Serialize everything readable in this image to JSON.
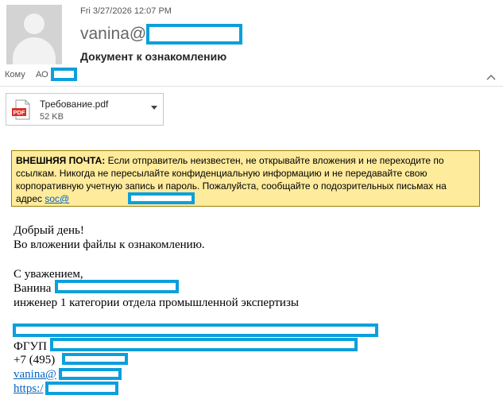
{
  "header": {
    "date": "Fri 3/27/2026 12:07 PM",
    "sender": "vanina@",
    "subject": "Документ к ознакомлению",
    "to_label": "Кому",
    "to_value": "АО"
  },
  "attachment": {
    "name": "Требование.pdf",
    "size": "52 KB",
    "icon": "pdf-icon"
  },
  "banner": {
    "label": "ВНЕШНЯЯ ПОЧТА:",
    "text": " Если отправитель неизвестен, не открывайте вложения и не переходите по ссылкам. Никогда не пересылайте конфиденциальную информацию и не передавайте свою корпоративную учетную запись и пароль. Пожалуйста, сообщайте о подозрительных письмах на адрес ",
    "link": "soc@"
  },
  "body": {
    "greeting": "Добрый день!",
    "line1": "Во вложении файлы к ознакомлению.",
    "regards": "С уважением,",
    "name": "Ванина",
    "position": "инженер 1 категории отдела промышленной экспертизы",
    "org": "ФГУП",
    "phone": "+7 (495)",
    "email": "vanina@",
    "site": "https:/"
  },
  "colors": {
    "banner_bg": "#ffeb9c",
    "link": "#0563c1",
    "redaction": "#0c9fdc",
    "pdf_red": "#d93025"
  }
}
